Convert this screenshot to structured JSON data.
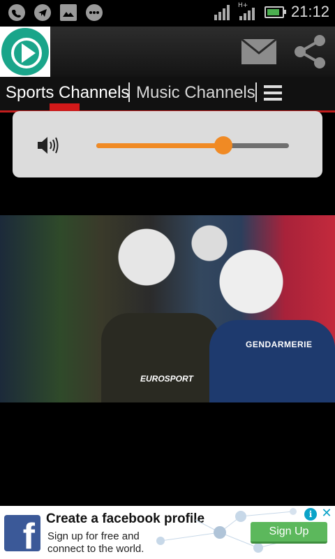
{
  "status_bar": {
    "time": "21:12",
    "network_label": "H+",
    "icons": [
      "whatsapp-icon",
      "telegram-icon",
      "gallery-icon",
      "chat-icon",
      "signal-icon",
      "data-signal-icon",
      "battery-icon"
    ]
  },
  "app_bar": {
    "logo_icon": "play-circle-logo",
    "actions": [
      "mail-icon",
      "share-icon"
    ]
  },
  "tabs": {
    "items": [
      {
        "label": "Sports Channels",
        "active": true
      },
      {
        "label": "Music Channels",
        "active": false
      }
    ],
    "menu_icon": "hamburger-menu-icon",
    "accent_color": "#d21919"
  },
  "volume": {
    "icon": "speaker-icon",
    "level": 0.66,
    "accent_color": "#f08a24"
  },
  "video": {
    "watermark": "EUROSPORT",
    "vest_text": "GENDARMERIE"
  },
  "ad": {
    "brand_icon": "facebook-logo",
    "title": "Create a facebook profile",
    "line1": "Sign up for free and",
    "line2": "connect to the world.",
    "cta_label": "Sign Up",
    "info_icon": "i",
    "close_icon": "✕"
  }
}
